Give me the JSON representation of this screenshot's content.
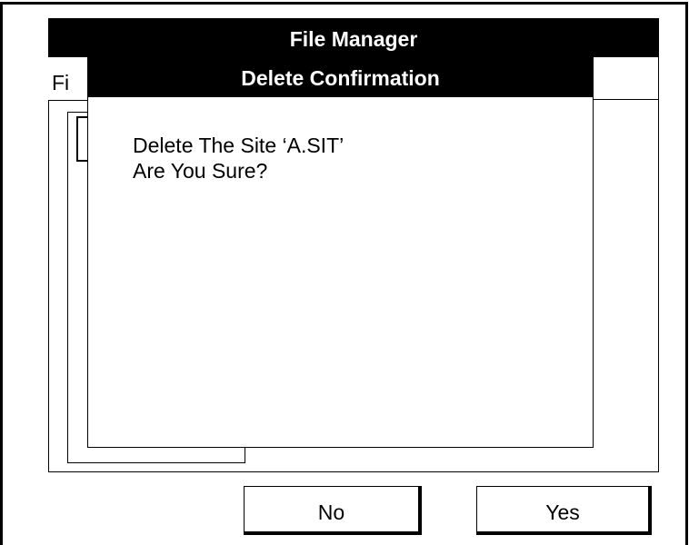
{
  "window": {
    "title": "File Manager"
  },
  "menu": {
    "truncated_label": "Fi"
  },
  "dialog": {
    "title": "Delete Confirmation",
    "message_line1": "Delete The Site ‘A.SIT’",
    "message_line2": "Are You Sure?"
  },
  "buttons": {
    "no_label": "No",
    "yes_label": "Yes"
  },
  "colors": {
    "titlebar_bg": "#000000",
    "titlebar_text": "#ffffff",
    "background": "#ffffff"
  }
}
